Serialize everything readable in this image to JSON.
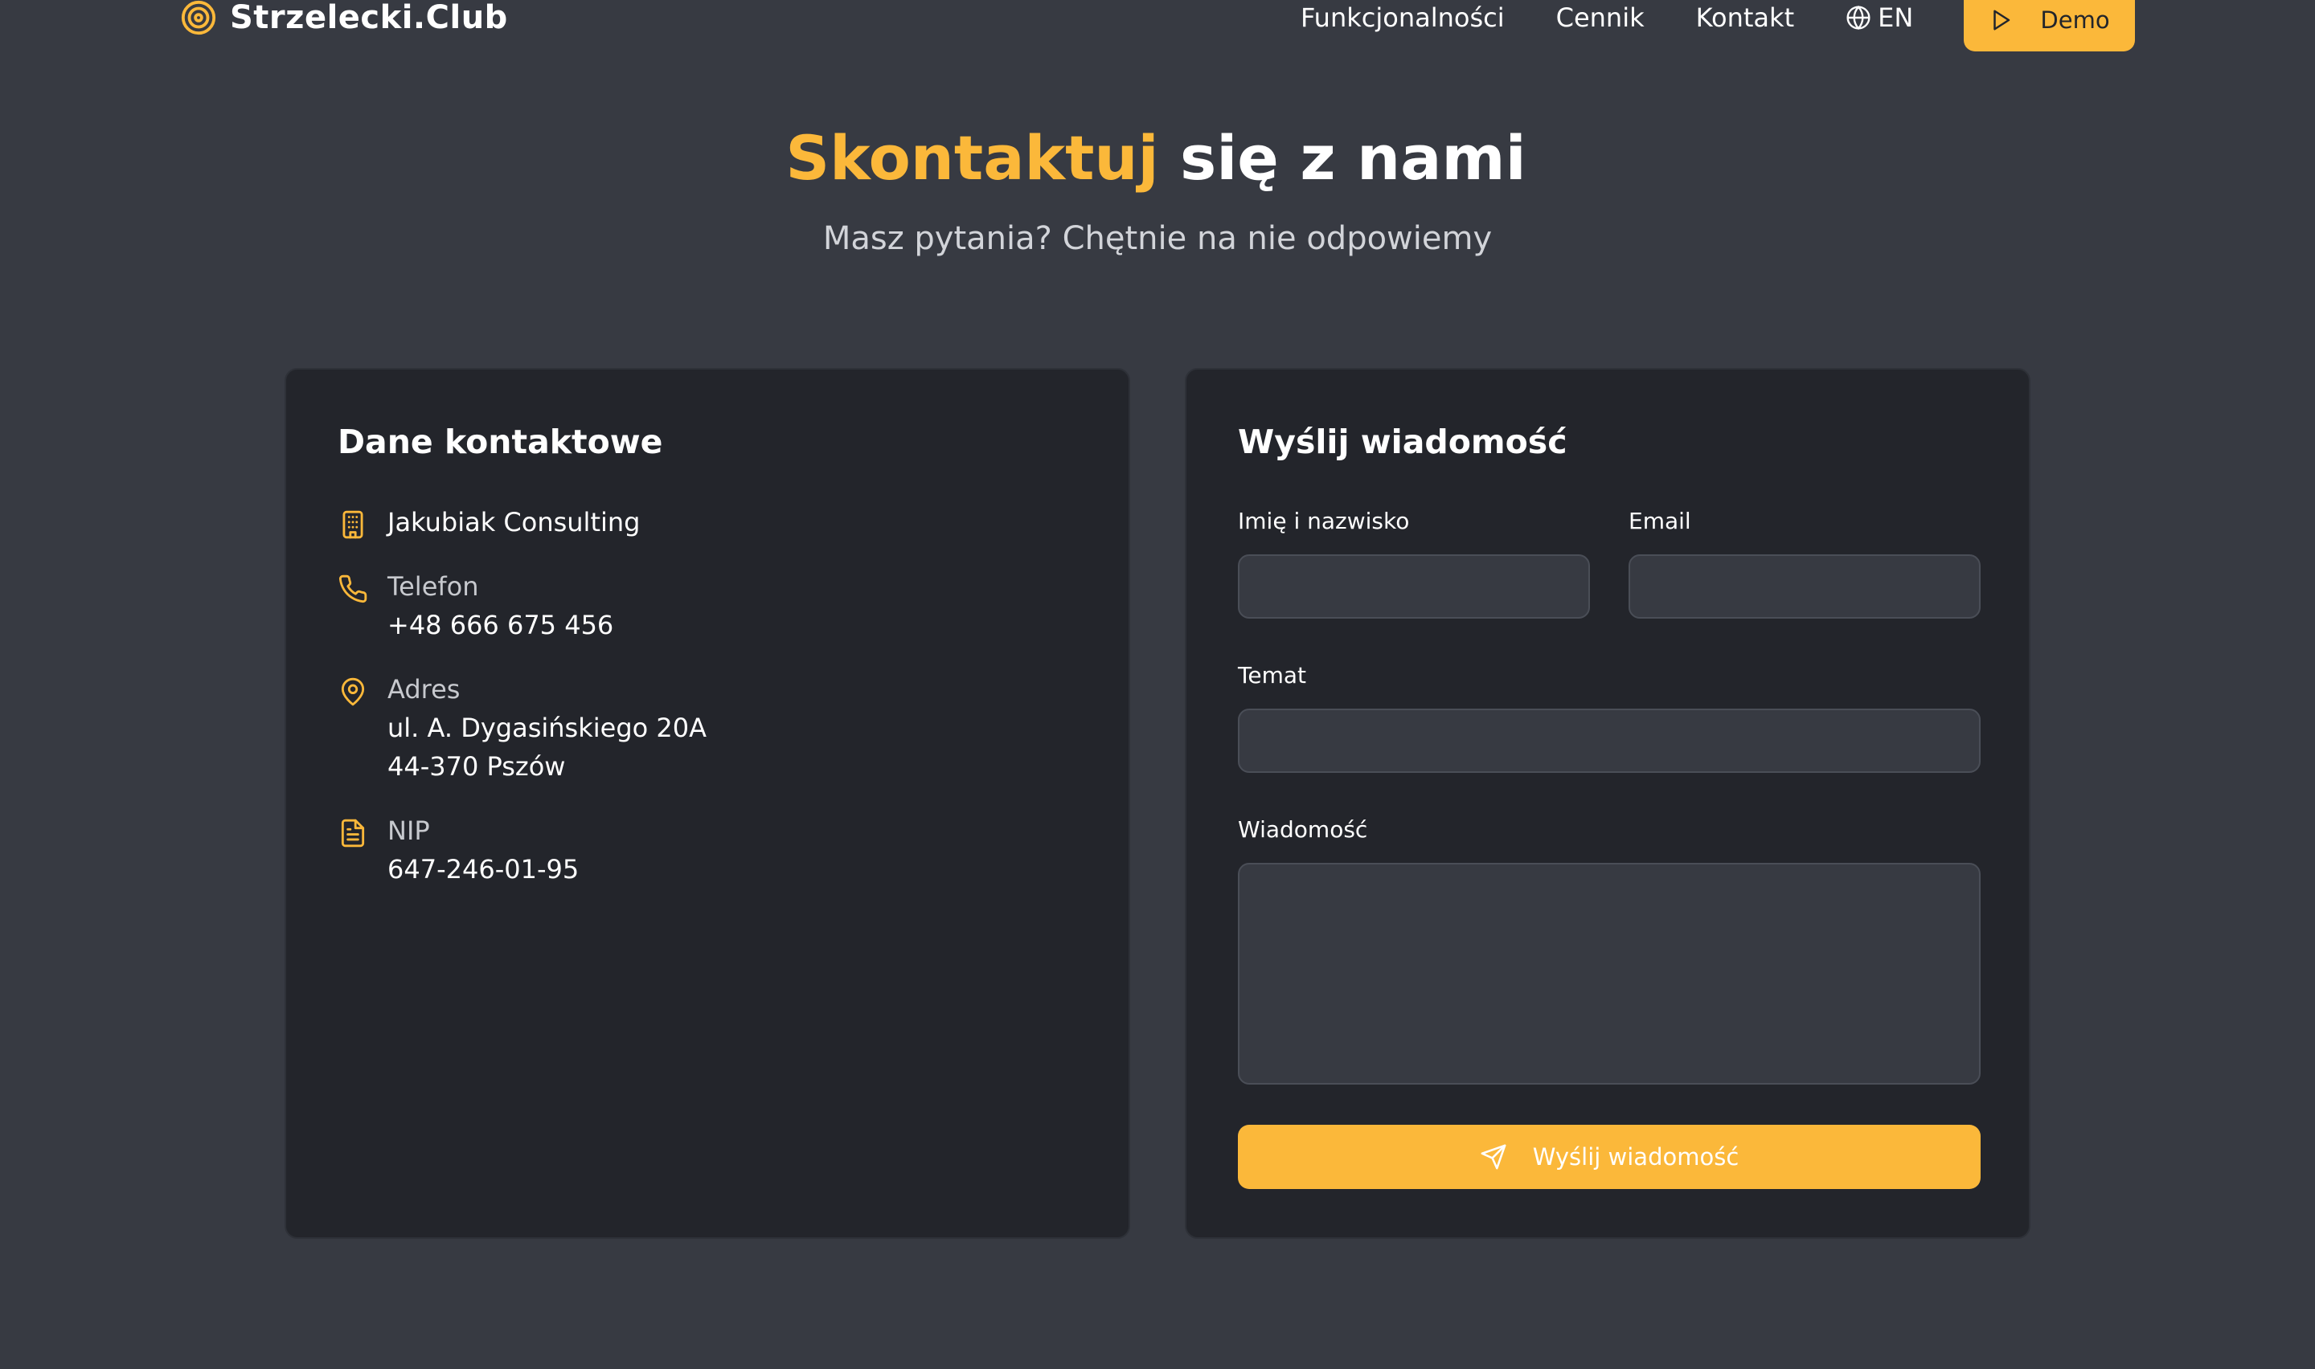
{
  "header": {
    "brand": "Strzelecki.Club",
    "nav": [
      {
        "label": "Funkcjonalności"
      },
      {
        "label": "Cennik"
      },
      {
        "label": "Kontakt"
      }
    ],
    "language": "EN",
    "demo_label": "Demo"
  },
  "hero": {
    "title_accent": "Skontaktuj",
    "title_rest": " się z nami",
    "subtitle": "Masz pytania? Chętnie na nie odpowiemy"
  },
  "contact": {
    "title": "Dane kontaktowe",
    "company": "Jakubiak Consulting",
    "phone_label": "Telefon",
    "phone": "+48 666 675 456",
    "address_label": "Adres",
    "address_line1": "ul. A. Dygasińskiego 20A",
    "address_line2": "44-370 Pszów",
    "nip_label": "NIP",
    "nip": "647-246-01-95"
  },
  "form": {
    "title": "Wyślij wiadomość",
    "name_label": "Imię i nazwisko",
    "name_value": "",
    "email_label": "Email",
    "email_value": "",
    "subject_label": "Temat",
    "subject_value": "",
    "message_label": "Wiadomość",
    "message_value": "",
    "submit_label": "Wyślij wiadomość"
  },
  "colors": {
    "accent": "#fbb83a",
    "background": "#373a42",
    "card": "#23252b"
  },
  "icons": {
    "logo": "target-icon",
    "language": "globe-icon",
    "demo": "play-icon",
    "company": "building-icon",
    "phone": "phone-icon",
    "address": "map-pin-icon",
    "nip": "document-icon",
    "submit": "send-icon"
  }
}
